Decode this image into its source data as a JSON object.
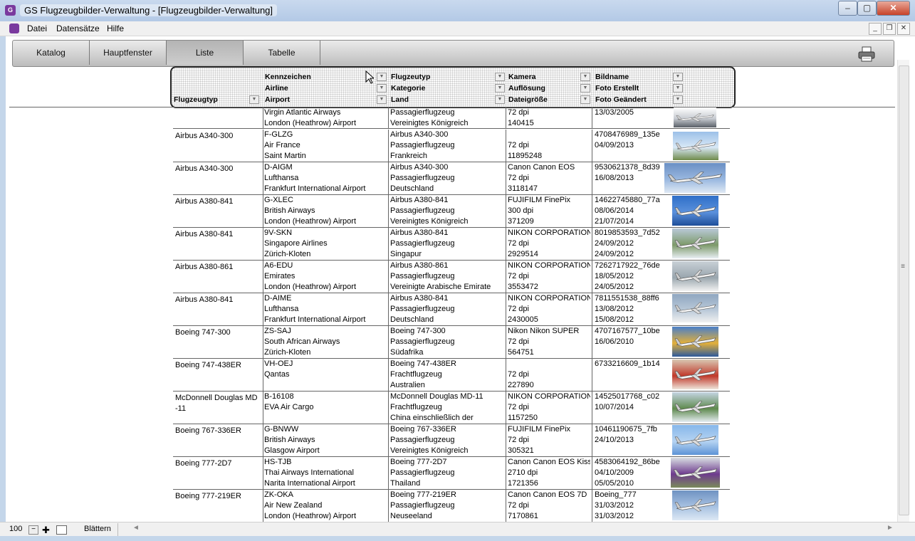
{
  "window": {
    "title": "GS Flugzeugbilder-Verwaltung - [Flugzeugbilder-Verwaltung]",
    "app_icon_glyph": "G"
  },
  "menu": {
    "items": [
      "Datei",
      "Datensätze",
      "Hilfe"
    ]
  },
  "tabs": [
    "Katalog",
    "Hauptfenster",
    "Liste",
    "Tabelle"
  ],
  "active_tab": "Liste",
  "header": {
    "col1": [
      "Flugzeugtyp"
    ],
    "col2": [
      "Kennzeichen",
      "Airline",
      "Airport"
    ],
    "col3": [
      "Flugzeutyp",
      "Kategorie",
      "Land"
    ],
    "col4": [
      "Kamera",
      "Auflösung",
      "Dateigröße"
    ],
    "col5": [
      "Bildname",
      "Foto Erstellt",
      "Foto Geändert"
    ]
  },
  "rows": [
    {
      "type": "",
      "c2": [
        "Virgin Atlantic Airways",
        "London (Heathrow) Airport",
        ""
      ],
      "c3": [
        "Passagierflugzeug",
        "Vereinigtes Königreich",
        ""
      ],
      "c4": [
        "72 dpi",
        "140415",
        ""
      ],
      "c5": [
        "13/03/2005",
        "",
        ""
      ],
      "img_colors": [
        "#ffffff",
        "#c8ccd2",
        "#5a6068"
      ]
    },
    {
      "type": "Airbus A340-300",
      "c2": [
        "F-GLZG",
        "Air France",
        "Saint Martin"
      ],
      "c3": [
        "Airbus A340-300",
        "Passagierflugzeug",
        "Frankreich"
      ],
      "c4": [
        "",
        "72 dpi",
        "11895248"
      ],
      "c5": [
        "4708476989_135e",
        "04/09/2013",
        ""
      ],
      "img_colors": [
        "#9cc0e8",
        "#d8e8f6",
        "#6f8b4a"
      ]
    },
    {
      "type": "Airbus A340-300",
      "c2": [
        "D-AIGM",
        "Lufthansa",
        "Frankfurt International Airport"
      ],
      "c3": [
        "Airbus A340-300",
        "Passagierflugzeug",
        "Deutschland"
      ],
      "c4": [
        "Canon Canon EOS",
        "72 dpi",
        "3118147"
      ],
      "c5": [
        "9530621378_8d39",
        "16/08/2013",
        ""
      ],
      "img_colors": [
        "#6a8fc4",
        "#9ab8e0",
        "#dfe9f4"
      ]
    },
    {
      "type": "Airbus A380-841",
      "c2": [
        "G-XLEC",
        "British Airways",
        "London (Heathrow) Airport"
      ],
      "c3": [
        "Airbus A380-841",
        "Passagierflugzeug",
        "Vereinigtes Königreich"
      ],
      "c4": [
        "FUJIFILM FinePix",
        "300 dpi",
        "371209"
      ],
      "c5": [
        "14622745880_77a",
        "08/06/2014",
        "21/07/2014"
      ],
      "img_colors": [
        "#2f6fc8",
        "#5a90dc",
        "#1d4e9a"
      ]
    },
    {
      "type": "Airbus A380-841",
      "c2": [
        "9V-SKN",
        "Singapore Airlines",
        "Zürich-Kloten"
      ],
      "c3": [
        "Airbus A380-841",
        "Passagierflugzeug",
        "Singapur"
      ],
      "c4": [
        "NIKON CORPORATION",
        "72 dpi",
        "2929514"
      ],
      "c5": [
        "8019853593_7d52",
        "24/09/2012",
        "24/09/2012"
      ],
      "img_colors": [
        "#b9c9d8",
        "#7d9a6a",
        "#e8eef4"
      ]
    },
    {
      "type": "Airbus A380-861",
      "c2": [
        "A6-EDU",
        "Emirates",
        "London (Heathrow) Airport"
      ],
      "c3": [
        "Airbus A380-861",
        "Passagierflugzeug",
        "Vereinigte Arabische Emirate"
      ],
      "c4": [
        "NIKON CORPORATION",
        "72 dpi",
        "3553472"
      ],
      "c5": [
        "7262717922_76de",
        "18/05/2012",
        "24/05/2012"
      ],
      "img_colors": [
        "#c8d0d6",
        "#9aa6ae",
        "#f2f2f2"
      ]
    },
    {
      "type": "Airbus A380-841",
      "c2": [
        "D-AIME",
        "Lufthansa",
        "Frankfurt International Airport"
      ],
      "c3": [
        "Airbus A380-841",
        "Passagierflugzeug",
        "Deutschland"
      ],
      "c4": [
        "NIKON CORPORATION",
        "72 dpi",
        "2430005"
      ],
      "c5": [
        "7811551538_88ff6",
        "13/08/2012",
        "15/08/2012"
      ],
      "img_colors": [
        "#8fa6c0",
        "#b8c8d8",
        "#f0f0f0"
      ]
    },
    {
      "type": "Boeing 747-300",
      "c2": [
        "ZS-SAJ",
        "South African Airways",
        "Zürich-Kloten"
      ],
      "c3": [
        "Boeing 747-300",
        "Passagierflugzeug",
        "Südafrika"
      ],
      "c4": [
        "Nikon Nikon SUPER",
        "72 dpi",
        "564751"
      ],
      "c5": [
        "4707167577_10be",
        "16/06/2010",
        ""
      ],
      "img_colors": [
        "#4a7fc8",
        "#e3b03a",
        "#2e5a9c"
      ]
    },
    {
      "type": "Boeing 747-438ER",
      "c2": [
        "VH-OEJ",
        "Qantas",
        ""
      ],
      "c3": [
        "Boeing 747-438ER",
        "Frachtflugzeug",
        "Australien"
      ],
      "c4": [
        "",
        "72 dpi",
        "227890"
      ],
      "c5": [
        "6733216609_1b14",
        "",
        ""
      ],
      "img_colors": [
        "#d9c7b2",
        "#c0392b",
        "#efe6dc"
      ]
    },
    {
      "type": "McDonnell Douglas MD -11",
      "c2": [
        "B-16108",
        "EVA Air Cargo",
        ""
      ],
      "c3": [
        "McDonnell Douglas MD-11",
        "Frachtflugzeug",
        "China einschließlich der"
      ],
      "c4": [
        "NIKON CORPORATION",
        "72 dpi",
        "1157250"
      ],
      "c5": [
        "14525017768_c02",
        "10/07/2014",
        ""
      ],
      "img_colors": [
        "#c4d4e2",
        "#5f8a4e",
        "#e6edf3"
      ]
    },
    {
      "type": "Boeing 767-336ER",
      "c2": [
        "G-BNWW",
        "British Airways",
        "Glasgow Airport"
      ],
      "c3": [
        "Boeing 767-336ER",
        "Passagierflugzeug",
        "Vereinigtes Königreich"
      ],
      "c4": [
        "FUJIFILM FinePix",
        "72 dpi",
        "305321"
      ],
      "c5": [
        "10461190675_7fb",
        "24/10/2013",
        ""
      ],
      "img_colors": [
        "#86b7ea",
        "#b5d3f2",
        "#5d93d6"
      ]
    },
    {
      "type": "Boeing 777-2D7",
      "c2": [
        "HS-TJB",
        "Thai Airways International",
        "Narita International Airport"
      ],
      "c3": [
        "Boeing 777-2D7",
        "Passagierflugzeug",
        "Thailand"
      ],
      "c4": [
        "Canon Canon EOS Kiss",
        "2710 dpi",
        "1721356"
      ],
      "c5": [
        "4583064192_86be",
        "04/10/2009",
        "05/05/2010"
      ],
      "img_colors": [
        "#d8dde2",
        "#6e3b8e",
        "#7a8a5a"
      ]
    },
    {
      "type": "Boeing 777-219ER",
      "c2": [
        "ZK-OKA",
        "Air New Zealand",
        "London (Heathrow) Airport"
      ],
      "c3": [
        "Boeing 777-219ER",
        "Passagierflugzeug",
        "Neuseeland"
      ],
      "c4": [
        "Canon Canon EOS 7D",
        "72 dpi",
        "7170861"
      ],
      "c5": [
        "Boeing_777",
        "31/03/2012",
        "31/03/2012"
      ],
      "img_colors": [
        "#6f93c2",
        "#a8c2e2",
        "#dde8f4"
      ]
    }
  ],
  "status": {
    "count": "100",
    "label": "Blättern"
  }
}
